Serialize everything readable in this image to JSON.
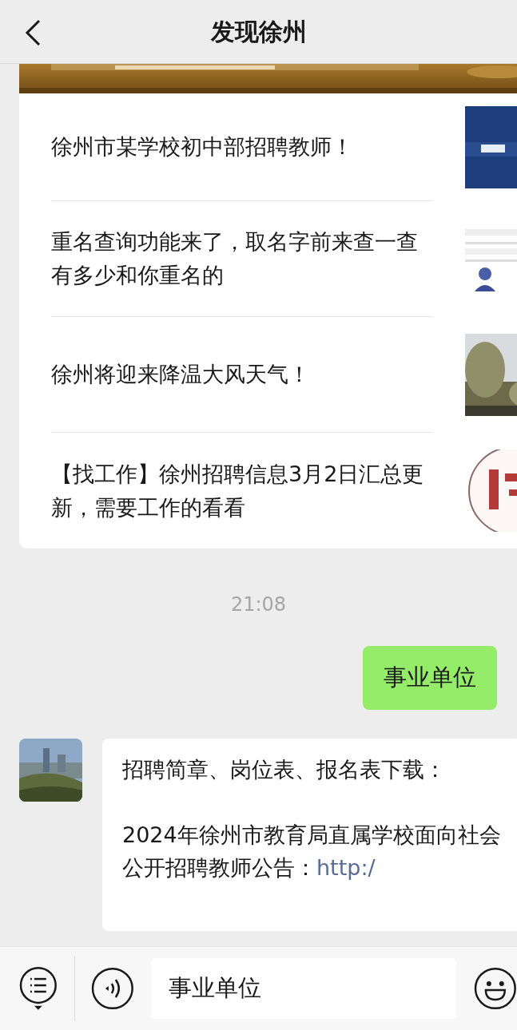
{
  "header": {
    "title": "发现徐州"
  },
  "article_card": {
    "items": [
      {
        "title": "徐州市某学校初中部招聘教师！"
      },
      {
        "title": "重名查询功能来了，取名字前来查一查有多少和你重名的"
      },
      {
        "title": "徐州将迎来降温大风天气！"
      },
      {
        "title": "【找工作】徐州招聘信息3月2日汇总更新，需要工作的看看"
      }
    ]
  },
  "timestamp": "21:08",
  "messages": [
    {
      "kind": "sent",
      "text": "事业单位"
    },
    {
      "kind": "received",
      "paragraphs": [
        "招聘简章、岗位表、报名表下载：",
        "2024年徐州市教育局直属学校面向社会公开招聘教师公告："
      ],
      "link": "http:/"
    }
  ],
  "input_bar": {
    "value": "事业单位"
  }
}
